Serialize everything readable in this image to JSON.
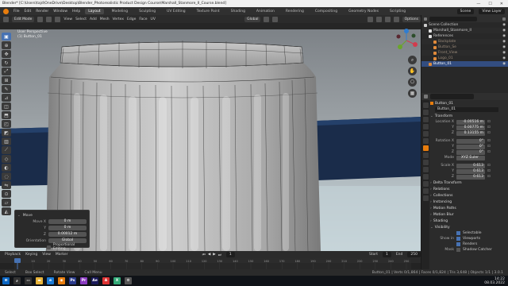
{
  "titlebar": {
    "title": "Blender* [C:\\Users\\tajd\\OneDrive\\Desktop\\Blender_Photorealistic Product Design Course\\Marshall_Stanmore_II_Course.blend]",
    "min": "—",
    "max": "☐",
    "close": "✕"
  },
  "menu": {
    "items": [
      "File",
      "Edit",
      "Render",
      "Window",
      "Help"
    ],
    "workspaces": [
      "Layout",
      "Modeling",
      "Sculpting",
      "UV Editing",
      "Texture Paint",
      "Shading",
      "Animation",
      "Rendering",
      "Compositing",
      "Geometry Nodes",
      "Scripting"
    ],
    "active_workspace": "Layout",
    "scene": "Scene",
    "view_layer": "View Layer"
  },
  "viewport_header": {
    "mode": "Edit Mode",
    "menus": [
      "View",
      "Select",
      "Add",
      "Mesh",
      "Vertex",
      "Edge",
      "Face",
      "UV"
    ],
    "orientation": "Global",
    "snapping": "Options"
  },
  "viewport": {
    "view_name": "User Perspective",
    "object_name": "(1) Button_01",
    "accent": "#4772b3"
  },
  "toolbar": {
    "tools": [
      "select-box",
      "cursor",
      "move",
      "rotate",
      "scale",
      "transform",
      "annotate",
      "measure",
      "add-cube",
      "extrude",
      "inset",
      "bevel",
      "loop-cut",
      "knife",
      "poly-build",
      "spin",
      "smooth",
      "edge-slide",
      "shrink-fatten",
      "shear",
      "rip-region"
    ],
    "active_index": 0
  },
  "operator_panel": {
    "title": "Move",
    "rows": [
      {
        "label": "Move X",
        "value": "0 m"
      },
      {
        "label": "Y",
        "value": "0 m"
      },
      {
        "label": "Z",
        "value": "0.00012 m"
      },
      {
        "label": "Orientation",
        "value": "Global"
      }
    ],
    "checkbox_label": "Proportional Editing"
  },
  "timeline": {
    "menus": [
      "Playback",
      "Keying",
      "View",
      "Marker"
    ],
    "current_frame": "1",
    "start_label": "Start",
    "start": "1",
    "end_label": "End",
    "end": "250",
    "ticks": [
      "0",
      "10",
      "20",
      "30",
      "40",
      "50",
      "60",
      "70",
      "80",
      "90",
      "100",
      "110",
      "120",
      "130",
      "140",
      "150",
      "160",
      "170",
      "180",
      "190",
      "200",
      "210",
      "220",
      "230",
      "240",
      "250"
    ]
  },
  "statusbar": {
    "items": [
      "Select",
      "Box Select",
      "Rotate View",
      "Call Menu"
    ],
    "stats": "Button_01 | Verts 0/1,864 | Faces 0/1,824 | Tris 3,648 | Objects 1/1 | 3.0.1"
  },
  "taskbar": {
    "time": "14:22",
    "date": "08.03.2022"
  },
  "outliner": {
    "title": "Scene Collection",
    "rows": [
      {
        "label": "Scene Collection",
        "indent": 0,
        "color": "#cccccc",
        "selected": false
      },
      {
        "label": "Marshall_Stanmore_II",
        "indent": 1,
        "color": "#e0e0e0",
        "selected": false
      },
      {
        "label": "References",
        "indent": 1,
        "color": "#e0e0e0",
        "selected": false
      },
      {
        "label": "Backplate",
        "indent": 2,
        "color": "#e08a3a",
        "selected": false
      },
      {
        "label": "Button_Se",
        "indent": 2,
        "color": "#e08a3a",
        "selected": false
      },
      {
        "label": "Front_View",
        "indent": 2,
        "color": "#e08a3a",
        "selected": false
      },
      {
        "label": "Logo_01",
        "indent": 2,
        "color": "#e08a3a",
        "selected": false
      },
      {
        "label": "Button_01",
        "indent": 1,
        "color": "#e08a3a",
        "selected": true
      }
    ]
  },
  "properties": {
    "object_name": "Button_01",
    "mesh_name": "Button_01",
    "sections": {
      "transform": "Transform",
      "delta": "Delta Transform",
      "relations": "Relations",
      "collections": "Collections",
      "instancing": "Instancing",
      "motion": "Motion Paths",
      "motion_blur": "Motion Blur",
      "shading": "Shading",
      "visibility": "Visibility"
    },
    "location": {
      "label": "Location X",
      "x": "-0.00516 m",
      "y": "0.00775 m",
      "z": "0.13155 m"
    },
    "rotation": {
      "label": "Rotation X",
      "x": "0°",
      "y": "0°",
      "z": "0°"
    },
    "mode": {
      "label": "Mode",
      "value": "XYZ Euler"
    },
    "scale": {
      "label": "Scale X",
      "x": "0.613",
      "y": "0.613",
      "z": "0.613"
    },
    "visibility": {
      "selectable": "Selectable",
      "show_in": "Show in",
      "viewports": "Viewports",
      "renders": "Renders",
      "mask": "Mask",
      "shadow_catcher": "Shadow Catcher"
    }
  }
}
